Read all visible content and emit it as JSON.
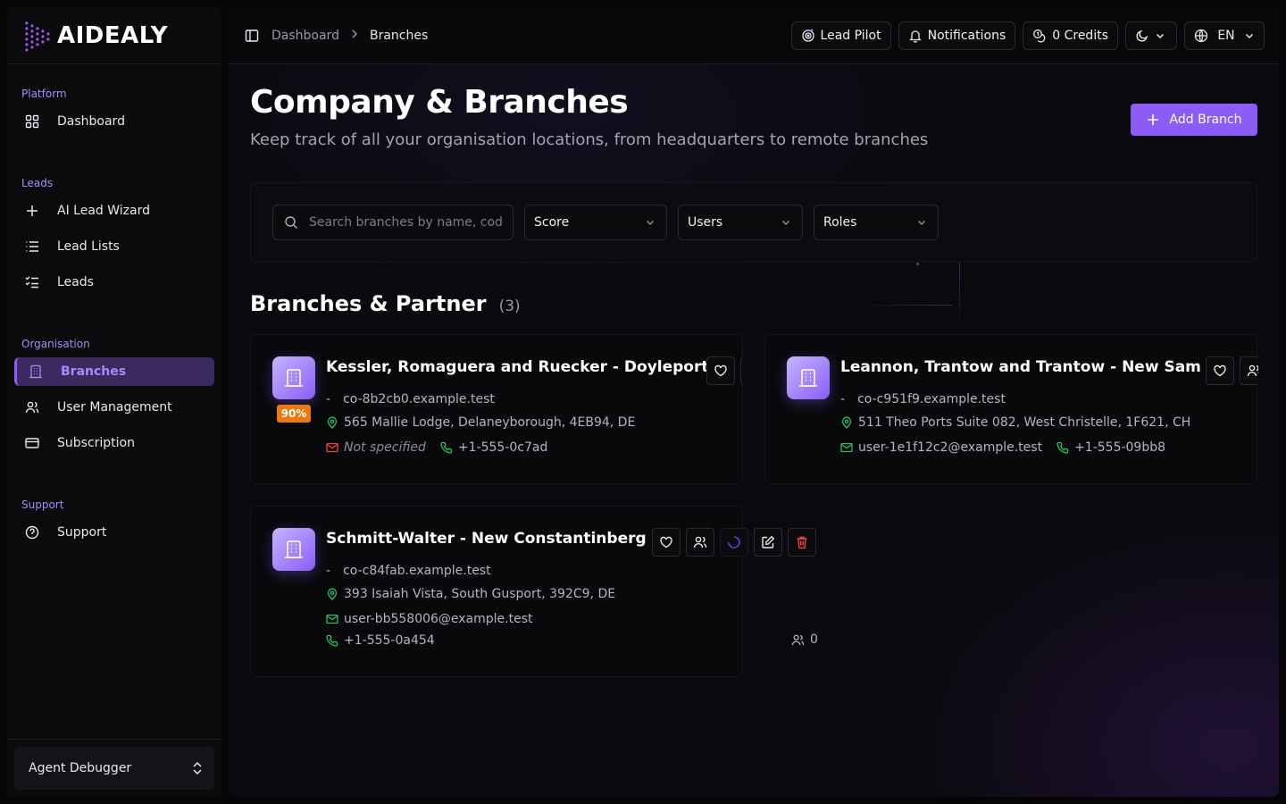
{
  "app": {
    "logo_text": "AIDEALY"
  },
  "sidebar": {
    "groups": [
      {
        "label": "Platform",
        "items": [
          {
            "label": "Dashboard"
          }
        ]
      },
      {
        "label": "Leads",
        "items": [
          {
            "label": "AI Lead Wizard"
          },
          {
            "label": "Lead Lists"
          },
          {
            "label": "Leads"
          }
        ]
      },
      {
        "label": "Organisation",
        "items": [
          {
            "label": "Branches"
          },
          {
            "label": "User Management"
          },
          {
            "label": "Subscription"
          }
        ]
      },
      {
        "label": "Support",
        "items": [
          {
            "label": "Support"
          }
        ]
      }
    ],
    "active_item": "Branches",
    "footer": {
      "label": "Agent Debugger"
    }
  },
  "topbar": {
    "breadcrumbs": [
      "Dashboard",
      "Branches"
    ],
    "lead_pilot": "Lead Pilot",
    "notifications": "Notifications",
    "credits": "0 Credits",
    "language": "EN"
  },
  "page": {
    "title": "Company & Branches",
    "subtitle": "Keep track of all your organisation locations, from headquarters to remote branches",
    "add_button": "Add Branch"
  },
  "filters": {
    "search_placeholder": "Search branches by name, code",
    "score": "Score",
    "users": "Users",
    "roles": "Roles"
  },
  "section": {
    "title": "Branches & Partner",
    "count": "(3)"
  },
  "branches": [
    {
      "name": "Kessler, Romaguera and Ruecker - Doyleport",
      "score": "90%",
      "domain": "co-8b2cb0.example.test",
      "address": "565 Mallie Lodge, Delaneyborough, 4EB94, DE",
      "email": "Not specified",
      "phone": "+1-555-0c7ad"
    },
    {
      "name": "Leannon, Trantow and Trantow - New Sam",
      "domain": "co-c951f9.example.test",
      "address": "511 Theo Ports Suite 082, West Christelle, 1F621, CH",
      "email": "user-1e1f12c2@example.test",
      "phone": "+1-555-09bb8"
    },
    {
      "name": "Schmitt-Walter - New Constantinberg",
      "domain": "co-c84fab.example.test",
      "address": "393 Isaiah Vista, South Gusport, 392C9, DE",
      "email": "user-bb558006@example.test",
      "phone": "+1-555-0a454",
      "users_count": "0"
    }
  ],
  "colors": {
    "accent": "#8b5cf6",
    "accent_light": "#a78bfa",
    "badge": "#ea7a0f",
    "success": "#22c55e",
    "danger": "#ef4444"
  }
}
